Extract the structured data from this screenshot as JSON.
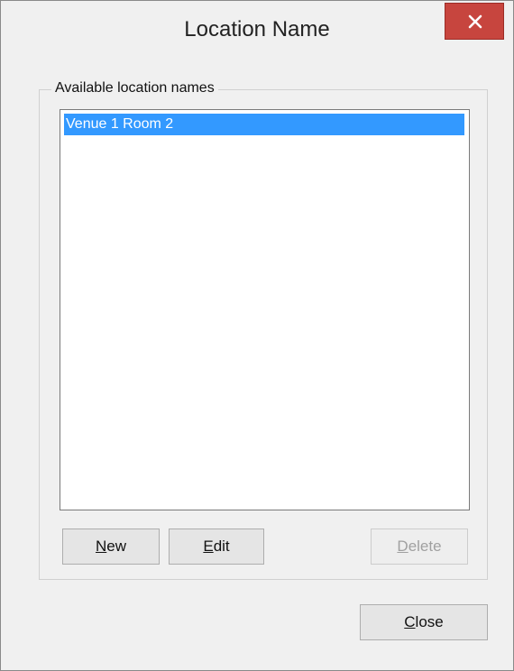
{
  "window": {
    "title": "Location Name",
    "close_icon": "close-icon"
  },
  "group": {
    "label": "Available location names"
  },
  "list": {
    "items": [
      "Venue 1 Room 2"
    ],
    "selected_index": 0
  },
  "buttons": {
    "new": {
      "mnemonic": "N",
      "rest": "ew"
    },
    "edit": {
      "mnemonic": "E",
      "rest": "dit"
    },
    "delete": {
      "mnemonic": "D",
      "rest": "elete",
      "disabled": true
    },
    "close": {
      "mnemonic": "C",
      "rest": "lose"
    }
  },
  "colors": {
    "selection": "#3399ff",
    "close_button": "#c7453e",
    "window_bg": "#f0f0f0"
  }
}
